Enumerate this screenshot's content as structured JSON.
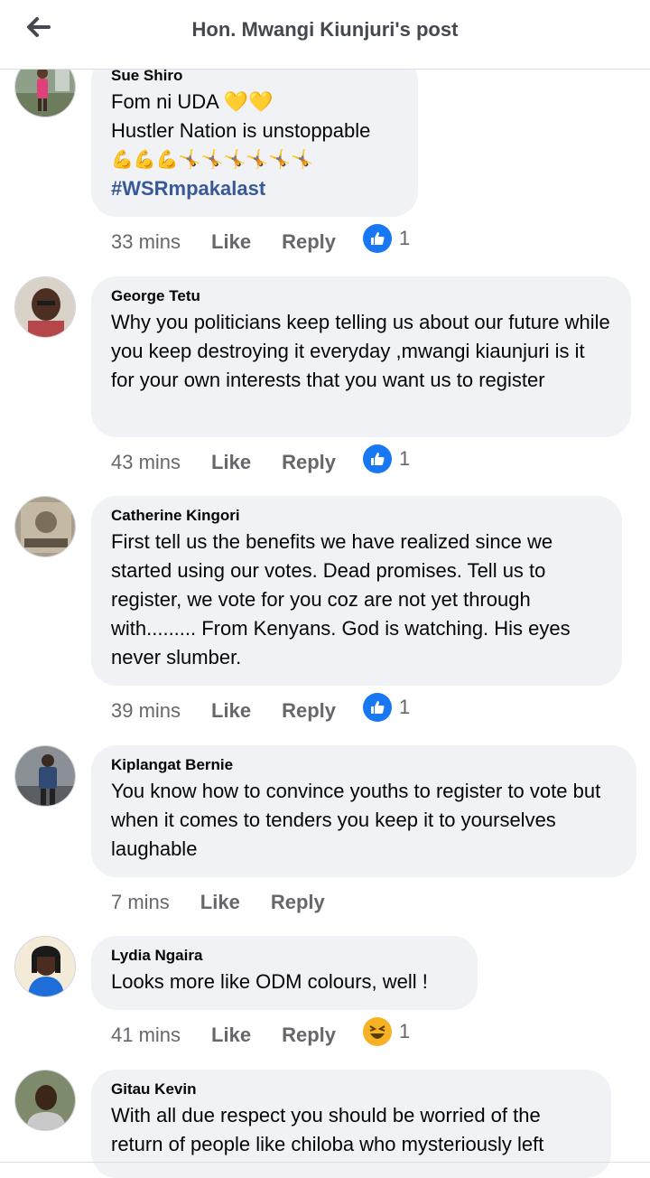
{
  "header": {
    "title": "Hon. Mwangi Kiunjuri's post",
    "back_icon": "arrow-left-icon"
  },
  "actions": {
    "like": "Like",
    "reply": "Reply"
  },
  "colors": {
    "bubble": "#f0f2f5",
    "like_blue": "#1877f2",
    "hashtag": "#385898",
    "meta_gray": "#65676b"
  },
  "comments": [
    {
      "author": "Sue Shiro",
      "lines": [
        "Fom ni UDA 💛💛",
        "Hustler Nation is unstoppable",
        "💪💪💪🤸🤸🤸🤸🤸🤸"
      ],
      "hashtag": "#WSRmpakalast",
      "time": "33 mins",
      "reaction": "like",
      "reaction_count": "1"
    },
    {
      "author": "George Tetu",
      "text": "Why you politicians keep telling us about our future while you keep destroying it everyday ,mwangi kiaunjuri is it for your own interests that you want us to register",
      "time": "43 mins",
      "reaction": "like",
      "reaction_count": "1"
    },
    {
      "author": "Catherine Kingori",
      "text": "First tell us the benefits we have realized since we started using our votes. Dead promises. Tell us to register, we vote for you coz are not yet through with......... From Kenyans. God is watching. His eyes never slumber.",
      "time": "39 mins",
      "reaction": "like",
      "reaction_count": "1"
    },
    {
      "author": "Kiplangat Bernie",
      "text": "You know how to convince youths to register to vote but when it comes to tenders you keep it to yourselves laughable",
      "time": "7 mins"
    },
    {
      "author": "Lydia Ngaira",
      "text": "Looks more like ODM colours, well !",
      "time": "41 mins",
      "reaction": "haha",
      "reaction_count": "1"
    },
    {
      "author": "Gitau Kevin",
      "text": "With all due respect you should be worried of the return of people like chiloba who mysteriously left"
    }
  ]
}
